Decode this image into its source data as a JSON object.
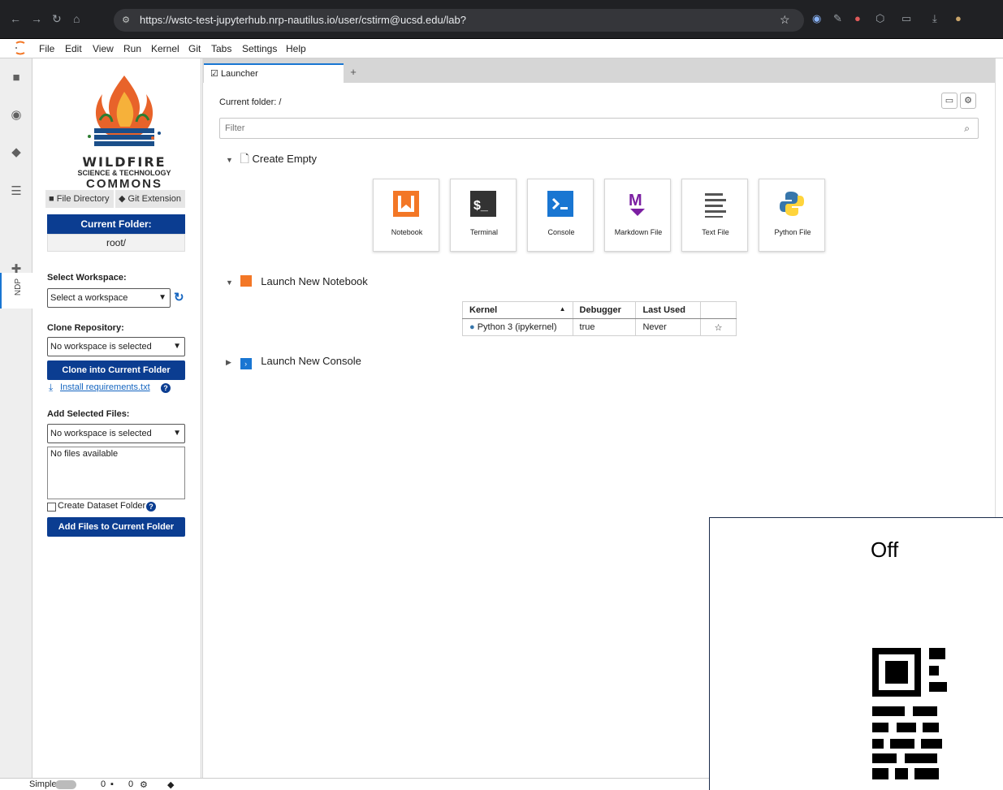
{
  "browser": {
    "url": "https://wstc-test-jupyterhub.nrp-nautilus.io/user/cstirm@ucsd.edu/lab?"
  },
  "menu": [
    "File",
    "Edit",
    "View",
    "Run",
    "Kernel",
    "Git",
    "Tabs",
    "Settings",
    "Help"
  ],
  "sidebar": {
    "logo_line1": "WILDFIRE",
    "logo_line2": "SCIENCE & TECHNOLOGY",
    "logo_line3": "COMMONS",
    "tab_file_directory": "File Directory",
    "tab_git_extension": "Git Extension",
    "current_folder_label": "Current Folder:",
    "current_folder_value": "root/",
    "select_workspace_label": "Select Workspace:",
    "workspace_select": "Select a workspace",
    "clone_repository_label": "Clone Repository:",
    "clone_select": "No workspace is selected",
    "clone_button": "Clone into Current Folder",
    "install_link": "Install requirements.txt",
    "add_files_label": "Add Selected Files:",
    "add_files_select": "No workspace is selected",
    "files_placeholder": "No files available",
    "create_dataset_label": "Create Dataset Folder",
    "add_files_button": "Add Files to Current Folder"
  },
  "rail": {
    "ndp_label": "NDP"
  },
  "tabs": {
    "launcher_label": "Launcher",
    "add_label": "+"
  },
  "launcher": {
    "current_folder": "Current folder: /",
    "filter_placeholder": "Filter",
    "create_empty": "Create Empty",
    "cards": [
      {
        "label": "Notebook"
      },
      {
        "label": "Terminal"
      },
      {
        "label": "Console"
      },
      {
        "label": "Markdown File"
      },
      {
        "label": "Text File"
      },
      {
        "label": "Python File"
      }
    ],
    "launch_notebook": "Launch New Notebook",
    "launch_console": "Launch New Console",
    "table": {
      "headers": [
        "Kernel",
        "Debugger",
        "Last Used"
      ],
      "row": {
        "kernel": "Python 3 (ipykernel)",
        "debugger": "true",
        "last_used": "Never"
      }
    }
  },
  "statusbar": {
    "mode": "Simple",
    "count1": "0",
    "count2": "0"
  },
  "overlay": {
    "title": "Off"
  },
  "colors": {
    "accent": "#0b3d91",
    "link": "#1565c0",
    "notebook": "#f37726",
    "markdown": "#7b1fa2",
    "console": "#1976d2"
  }
}
